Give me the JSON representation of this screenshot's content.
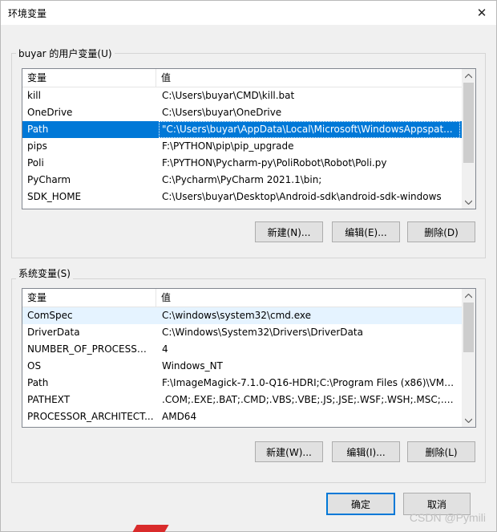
{
  "window": {
    "title": "环境变量",
    "close_glyph": "✕"
  },
  "user_vars": {
    "group_label": "buyar 的用户变量(U)",
    "col_name": "变量",
    "col_value": "值",
    "rows": [
      {
        "name": "kill",
        "value": "C:\\Users\\buyar\\CMD\\kill.bat"
      },
      {
        "name": "OneDrive",
        "value": "C:\\Users\\buyar\\OneDrive"
      },
      {
        "name": "Path",
        "value": "\"C:\\Users\\buyar\\AppData\\Local\\Microsoft\\WindowsAppspat..."
      },
      {
        "name": "pips",
        "value": "F:\\PYTHON\\pip\\pip_upgrade"
      },
      {
        "name": "Poli",
        "value": "F:\\PYTHON\\Pycharm-py\\PoliRobot\\Robot\\Poli.py"
      },
      {
        "name": "PyCharm",
        "value": "C:\\Pycharm\\PyCharm 2021.1\\bin;"
      },
      {
        "name": "SDK_HOME",
        "value": "C:\\Users\\buyar\\Desktop\\Android-sdk\\android-sdk-windows"
      }
    ],
    "new_button": "新建(N)...",
    "edit_button": "编辑(E)...",
    "delete_button": "删除(D)"
  },
  "system_vars": {
    "group_label": "系统变量(S)",
    "col_name": "变量",
    "col_value": "值",
    "rows": [
      {
        "name": "ComSpec",
        "value": "C:\\windows\\system32\\cmd.exe"
      },
      {
        "name": "DriverData",
        "value": "C:\\Windows\\System32\\Drivers\\DriverData"
      },
      {
        "name": "NUMBER_OF_PROCESSORS",
        "value": "4"
      },
      {
        "name": "OS",
        "value": "Windows_NT"
      },
      {
        "name": "Path",
        "value": "F:\\ImageMagick-7.1.0-Q16-HDRI;C:\\Program Files (x86)\\VMw..."
      },
      {
        "name": "PATHEXT",
        "value": ".COM;.EXE;.BAT;.CMD;.VBS;.VBE;.JS;.JSE;.WSF;.WSH;.MSC;.PY;.P..."
      },
      {
        "name": "PROCESSOR_ARCHITECT...",
        "value": "AMD64"
      }
    ],
    "new_button": "新建(W)...",
    "edit_button": "编辑(I)...",
    "delete_button": "删除(L)"
  },
  "footer": {
    "ok_button": "确定",
    "cancel_button": "取消"
  },
  "watermark": "CSDN @Pymili",
  "colors": {
    "selection": "#0078d7",
    "hover": "#e5f3ff",
    "button_face": "#e1e1e1",
    "primary_border": "#0078d7"
  }
}
